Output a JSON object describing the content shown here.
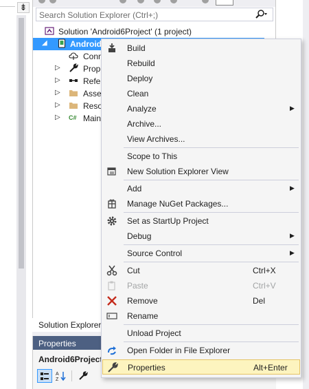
{
  "search": {
    "placeholder": "Search Solution Explorer (Ctrl+;)"
  },
  "tree": {
    "solution_label": "Solution 'Android6Project' (1 project)",
    "project_label": "Android",
    "items": [
      {
        "label": "Conn",
        "icon": "connected-services-icon"
      },
      {
        "label": "Prope",
        "icon": "wrench-icon"
      },
      {
        "label": "Refer",
        "icon": "references-icon"
      },
      {
        "label": "Asset",
        "icon": "folder-icon"
      },
      {
        "label": "Resou",
        "icon": "folder-icon"
      },
      {
        "label": "Main",
        "icon": "csharp-file-icon"
      }
    ]
  },
  "explorer_tab": {
    "label": "Solution Explorer"
  },
  "properties": {
    "title": "Properties",
    "object": "Android6Project"
  },
  "context_menu": {
    "items": [
      {
        "label": "Build",
        "icon": "build-icon"
      },
      {
        "label": "Rebuild"
      },
      {
        "label": "Deploy"
      },
      {
        "label": "Clean"
      },
      {
        "label": "Analyze",
        "submenu": true
      },
      {
        "label": "Archive..."
      },
      {
        "label": "View Archives..."
      },
      {
        "label": "Scope to This"
      },
      {
        "label": "New Solution Explorer View",
        "icon": "new-view-icon"
      },
      {
        "label": "Add",
        "submenu": true
      },
      {
        "label": "Manage NuGet Packages...",
        "icon": "nuget-icon"
      },
      {
        "label": "Set as StartUp Project",
        "icon": "gear-icon"
      },
      {
        "label": "Debug",
        "submenu": true
      },
      {
        "label": "Source Control",
        "submenu": true
      },
      {
        "label": "Cut",
        "shortcut": "Ctrl+X",
        "icon": "scissors-icon"
      },
      {
        "label": "Paste",
        "shortcut": "Ctrl+V",
        "icon": "paste-icon",
        "disabled": true
      },
      {
        "label": "Remove",
        "shortcut": "Del",
        "icon": "remove-x-icon"
      },
      {
        "label": "Rename",
        "icon": "rename-icon"
      },
      {
        "label": "Unload Project"
      },
      {
        "label": "Open Folder in File Explorer",
        "icon": "refresh-arrow-icon"
      },
      {
        "label": "Properties",
        "shortcut": "Alt+Enter",
        "icon": "wrench-icon",
        "highlighted": true
      }
    ]
  },
  "colors": {
    "selection": "#3399ff",
    "menu_bg": "#f5f5f5",
    "highlight": "#fdf4bf",
    "properties_header": "#4d6082",
    "remove_icon": "#c42b1c"
  }
}
